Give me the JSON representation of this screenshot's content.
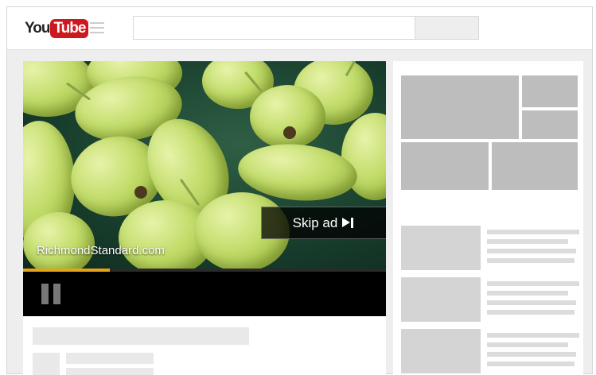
{
  "header": {
    "logo": {
      "part1": "You",
      "part2": "Tube"
    },
    "icons": {
      "menu": "hamburger-menu-icon"
    }
  },
  "player": {
    "watermark": "RichmondStandard.com",
    "skip_label": "Skip ad",
    "skip_icon": "skip-next-icon",
    "progress_fraction": 0.24,
    "progress_color": "#e6a317",
    "pause_icon": "pause-icon"
  },
  "colors": {
    "brand_red": "#cc181e",
    "controls_bg": "#000000",
    "page_bg": "#eeeeee"
  }
}
